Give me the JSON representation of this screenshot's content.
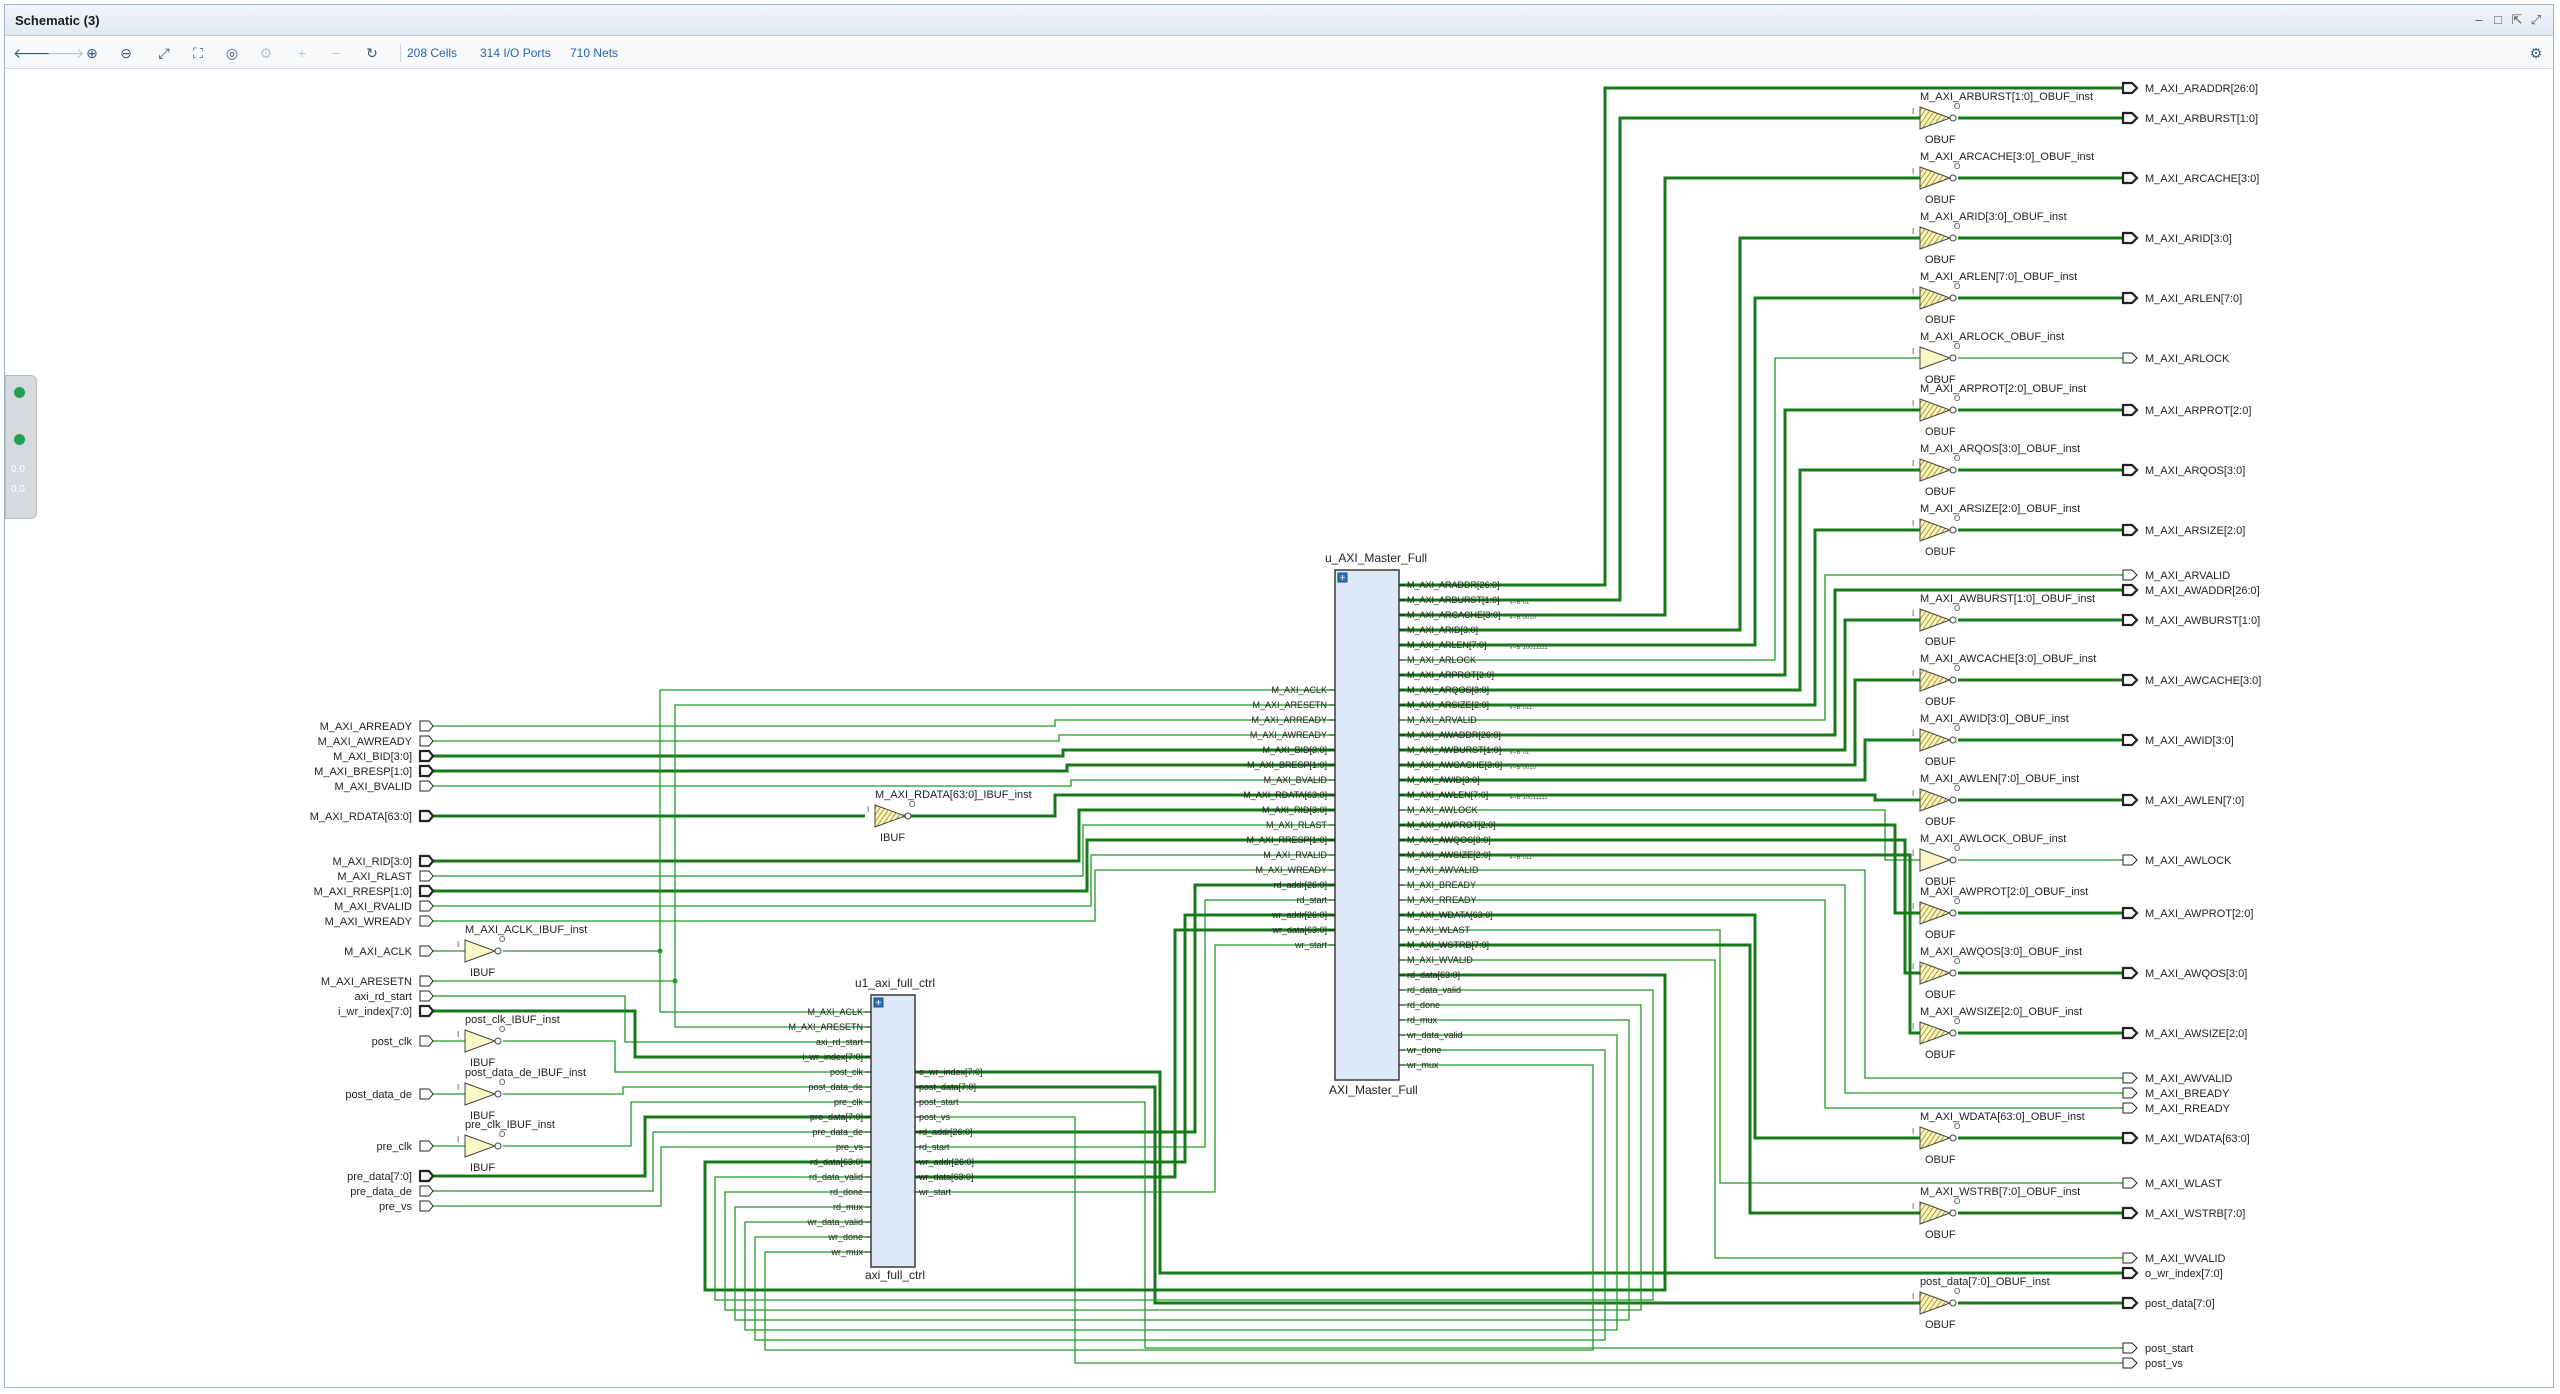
{
  "window": {
    "title": "Schematic (3)"
  },
  "toolbar": {
    "buttons": [
      {
        "name": "back",
        "glyph": "🡐",
        "enabled": true
      },
      {
        "name": "forward",
        "glyph": "🡒",
        "enabled": false
      },
      {
        "name": "zoom-in",
        "glyph": "⊕",
        "enabled": true
      },
      {
        "name": "zoom-out",
        "glyph": "⊖",
        "enabled": true
      },
      {
        "name": "zoom-fit",
        "glyph": "⤢",
        "enabled": true
      },
      {
        "name": "zoom-area",
        "glyph": "⛶",
        "enabled": true
      },
      {
        "name": "select",
        "glyph": "◎",
        "enabled": true
      },
      {
        "name": "regenerate",
        "glyph": "⚙",
        "enabled": false
      },
      {
        "name": "expand",
        "glyph": "+",
        "enabled": false
      },
      {
        "name": "collapse",
        "glyph": "−",
        "enabled": false
      },
      {
        "name": "refresh",
        "glyph": "↻",
        "enabled": true
      }
    ],
    "cells": "208 Cells",
    "ports": "314 I/O Ports",
    "nets": "710 Nets",
    "settings_glyph": "⚙"
  },
  "side_panel": {
    "line1": "0.0",
    "line2": "0.0"
  },
  "schematic": {
    "inputs": [
      {
        "label": "M_AXI_ARREADY",
        "bus": false
      },
      {
        "label": "M_AXI_AWREADY",
        "bus": false
      },
      {
        "label": "M_AXI_BID[3:0]",
        "bus": true
      },
      {
        "label": "M_AXI_BRESP[1:0]",
        "bus": true
      },
      {
        "label": "M_AXI_BVALID",
        "bus": false
      },
      {
        "label": "M_AXI_RDATA[63:0]",
        "bus": true
      },
      {
        "label": "M_AXI_RID[3:0]",
        "bus": true
      },
      {
        "label": "M_AXI_RLAST",
        "bus": false
      },
      {
        "label": "M_AXI_RRESP[1:0]",
        "bus": true
      },
      {
        "label": "M_AXI_RVALID",
        "bus": false
      },
      {
        "label": "M_AXI_WREADY",
        "bus": false
      },
      {
        "label": "M_AXI_ACLK",
        "bus": false
      },
      {
        "label": "M_AXI_ARESETN",
        "bus": false
      },
      {
        "label": "axi_rd_start",
        "bus": false
      },
      {
        "label": "i_wr_index[7:0]",
        "bus": true
      },
      {
        "label": "post_clk",
        "bus": false
      },
      {
        "label": "post_data_de",
        "bus": false
      },
      {
        "label": "pre_clk",
        "bus": false
      },
      {
        "label": "pre_data[7:0]",
        "bus": true
      },
      {
        "label": "pre_data_de",
        "bus": false
      },
      {
        "label": "pre_vs",
        "bus": false
      }
    ],
    "outputs": [
      {
        "label": "M_AXI_ARADDR[26:0]",
        "bus": true
      },
      {
        "label": "M_AXI_ARBURST[1:0]",
        "bus": true
      },
      {
        "label": "M_AXI_ARCACHE[3:0]",
        "bus": true
      },
      {
        "label": "M_AXI_ARID[3:0]",
        "bus": true
      },
      {
        "label": "M_AXI_ARLEN[7:0]",
        "bus": true
      },
      {
        "label": "M_AXI_ARLOCK",
        "bus": false
      },
      {
        "label": "M_AXI_ARPROT[2:0]",
        "bus": true
      },
      {
        "label": "M_AXI_ARQOS[3:0]",
        "bus": true
      },
      {
        "label": "M_AXI_ARSIZE[2:0]",
        "bus": true
      },
      {
        "label": "M_AXI_ARVALID",
        "bus": false
      },
      {
        "label": "M_AXI_AWADDR[26:0]",
        "bus": true
      },
      {
        "label": "M_AXI_AWBURST[1:0]",
        "bus": true
      },
      {
        "label": "M_AXI_AWCACHE[3:0]",
        "bus": true
      },
      {
        "label": "M_AXI_AWID[3:0]",
        "bus": true
      },
      {
        "label": "M_AXI_AWLEN[7:0]",
        "bus": true
      },
      {
        "label": "M_AXI_AWLOCK",
        "bus": false
      },
      {
        "label": "M_AXI_AWPROT[2:0]",
        "bus": true
      },
      {
        "label": "M_AXI_AWQOS[3:0]",
        "bus": true
      },
      {
        "label": "M_AXI_AWSIZE[2:0]",
        "bus": true
      },
      {
        "label": "M_AXI_AWVALID",
        "bus": false
      },
      {
        "label": "M_AXI_BREADY",
        "bus": false
      },
      {
        "label": "M_AXI_RREADY",
        "bus": false
      },
      {
        "label": "M_AXI_WDATA[63:0]",
        "bus": true
      },
      {
        "label": "M_AXI_WLAST",
        "bus": false
      },
      {
        "label": "M_AXI_WSTRB[7:0]",
        "bus": true
      },
      {
        "label": "M_AXI_WVALID",
        "bus": false
      },
      {
        "label": "o_wr_index[7:0]",
        "bus": true
      },
      {
        "label": "post_data[7:0]",
        "bus": true
      },
      {
        "label": "post_start",
        "bus": false
      },
      {
        "label": "post_vs",
        "bus": false
      }
    ],
    "obufs": [
      {
        "inst": "M_AXI_ARBURST[1:0]_OBUF_inst",
        "type": "OBUF",
        "bus": true
      },
      {
        "inst": "M_AXI_ARCACHE[3:0]_OBUF_inst",
        "type": "OBUF",
        "bus": true
      },
      {
        "inst": "M_AXI_ARID[3:0]_OBUF_inst",
        "type": "OBUF",
        "bus": true
      },
      {
        "inst": "M_AXI_ARLEN[7:0]_OBUF_inst",
        "type": "OBUF",
        "bus": true
      },
      {
        "inst": "M_AXI_ARLOCK_OBUF_inst",
        "type": "OBUF",
        "bus": false
      },
      {
        "inst": "M_AXI_ARPROT[2:0]_OBUF_inst",
        "type": "OBUF",
        "bus": true
      },
      {
        "inst": "M_AXI_ARQOS[3:0]_OBUF_inst",
        "type": "OBUF",
        "bus": true
      },
      {
        "inst": "M_AXI_ARSIZE[2:0]_OBUF_inst",
        "type": "OBUF",
        "bus": true
      },
      {
        "inst": "M_AXI_AWBURST[1:0]_OBUF_inst",
        "type": "OBUF",
        "bus": true
      },
      {
        "inst": "M_AXI_AWCACHE[3:0]_OBUF_inst",
        "type": "OBUF",
        "bus": true
      },
      {
        "inst": "M_AXI_AWID[3:0]_OBUF_inst",
        "type": "OBUF",
        "bus": true
      },
      {
        "inst": "M_AXI_AWLEN[7:0]_OBUF_inst",
        "type": "OBUF",
        "bus": true
      },
      {
        "inst": "M_AXI_AWLOCK_OBUF_inst",
        "type": "OBUF",
        "bus": false
      },
      {
        "inst": "M_AXI_AWPROT[2:0]_OBUF_inst",
        "type": "OBUF",
        "bus": true
      },
      {
        "inst": "M_AXI_AWQOS[3:0]_OBUF_inst",
        "type": "OBUF",
        "bus": true
      },
      {
        "inst": "M_AXI_AWSIZE[2:0]_OBUF_inst",
        "type": "OBUF",
        "bus": true
      },
      {
        "inst": "M_AXI_WDATA[63:0]_OBUF_inst",
        "type": "OBUF",
        "bus": true
      },
      {
        "inst": "M_AXI_WSTRB[7:0]_OBUF_inst",
        "type": "OBUF",
        "bus": true
      },
      {
        "inst": "post_data[7:0]_OBUF_inst",
        "type": "OBUF",
        "bus": true
      }
    ],
    "ibufs": [
      {
        "inst": "M_AXI_RDATA[63:0]_IBUF_inst",
        "type": "IBUF",
        "bus": true
      },
      {
        "inst": "M_AXI_ACLK_IBUF_inst",
        "type": "IBUF",
        "bus": false
      },
      {
        "inst": "post_clk_IBUF_inst",
        "type": "IBUF",
        "bus": false
      },
      {
        "inst": "post_data_de_IBUF_inst",
        "type": "IBUF",
        "bus": false
      },
      {
        "inst": "pre_clk_IBUF_inst",
        "type": "IBUF",
        "bus": false
      }
    ],
    "buf_pins": {
      "in": "I",
      "out": "O"
    },
    "master": {
      "inst": "u_AXI_Master_Full",
      "type": "AXI_Master_Full",
      "left_pins": [
        "M_AXI_ACLK",
        "M_AXI_ARESETN",
        "M_AXI_ARREADY",
        "M_AXI_AWREADY",
        "M_AXI_BID[3:0]",
        "M_AXI_BRESP[1:0]",
        "M_AXI_BVALID",
        "M_AXI_RDATA[63:0]",
        "M_AXI_RID[3:0]",
        "M_AXI_RLAST",
        "M_AXI_RRESP[1:0]",
        "M_AXI_RVALID",
        "M_AXI_WREADY",
        "rd_addr[26:0]",
        "rd_start",
        "wr_addr[26:0]",
        "wr_data[63:0]",
        "wr_start"
      ],
      "right_pins": [
        "M_AXI_ARADDR[26:0]",
        "M_AXI_ARBURST[1:0]",
        "M_AXI_ARCACHE[3:0]",
        "M_AXI_ARID[3:0]",
        "M_AXI_ARLEN[7:0]",
        "M_AXI_ARLOCK",
        "M_AXI_ARPROT[2:0]",
        "M_AXI_ARQOS[3:0]",
        "M_AXI_ARSIZE[2:0]",
        "M_AXI_ARVALID",
        "M_AXI_AWADDR[26:0]",
        "M_AXI_AWBURST[1:0]",
        "M_AXI_AWCACHE[3:0]",
        "M_AXI_AWID[3:0]",
        "M_AXI_AWLEN[7:0]",
        "M_AXI_AWLOCK",
        "M_AXI_AWPROT[2:0]",
        "M_AXI_AWQOS[3:0]",
        "M_AXI_AWSIZE[2:0]",
        "M_AXI_AWVALID",
        "M_AXI_BREADY",
        "M_AXI_RREADY",
        "M_AXI_WDATA[63:0]",
        "M_AXI_WLAST",
        "M_AXI_WSTRB[7:0]",
        "M_AXI_WVALID",
        "rd_data[63:0]",
        "rd_data_valid",
        "rd_done",
        "rd_mux",
        "wr_data_valid",
        "wr_done",
        "wr_mux"
      ],
      "constants": [
        {
          "pin": "M_AXI_ARBURST[1:0]",
          "value": "V=B\"01\""
        },
        {
          "pin": "M_AXI_ARCACHE[3:0]",
          "value": "V=B\"0010\""
        },
        {
          "pin": "M_AXI_ARLEN[7:0]",
          "value": "V=B\"10011111\""
        },
        {
          "pin": "M_AXI_ARSIZE[2:0]",
          "value": "V=B\"011\""
        },
        {
          "pin": "M_AXI_AWBURST[1:0]",
          "value": "V=B\"01\""
        },
        {
          "pin": "M_AXI_AWCACHE[3:0]",
          "value": "V=B\"0010\""
        },
        {
          "pin": "M_AXI_AWLEN[7:0]",
          "value": "V=B\"10011111\""
        },
        {
          "pin": "M_AXI_AWSIZE[2:0]",
          "value": "V=B\"011\""
        }
      ]
    },
    "ctrl": {
      "inst": "u1_axi_full_ctrl",
      "type": "axi_full_ctrl",
      "left_pins": [
        "M_AXI_ACLK",
        "M_AXI_ARESETN",
        "axi_rd_start",
        "i_wr_index[7:0]",
        "post_clk",
        "post_data_de",
        "pre_clk",
        "pre_data[7:0]",
        "pre_data_de",
        "pre_vs",
        "rd_data[63:0]",
        "rd_data_valid",
        "rd_done",
        "rd_mux",
        "wr_data_valid",
        "wr_done",
        "wr_mux"
      ],
      "right_pins": [
        "o_wr_index[7:0]",
        "post_data[7:0]",
        "post_start",
        "post_vs",
        "rd_addr[26:0]",
        "rd_start",
        "wr_addr[26:0]",
        "wr_data[63:0]",
        "wr_start"
      ]
    },
    "colors": {
      "net": "#1f9b24",
      "bus": "#167a1a",
      "cell_fill": "#dde9f7",
      "cell_border": "#3a3a3a",
      "buffer_fill": "#fbf6c3",
      "buffer_hatch": "#b39a2f"
    }
  }
}
